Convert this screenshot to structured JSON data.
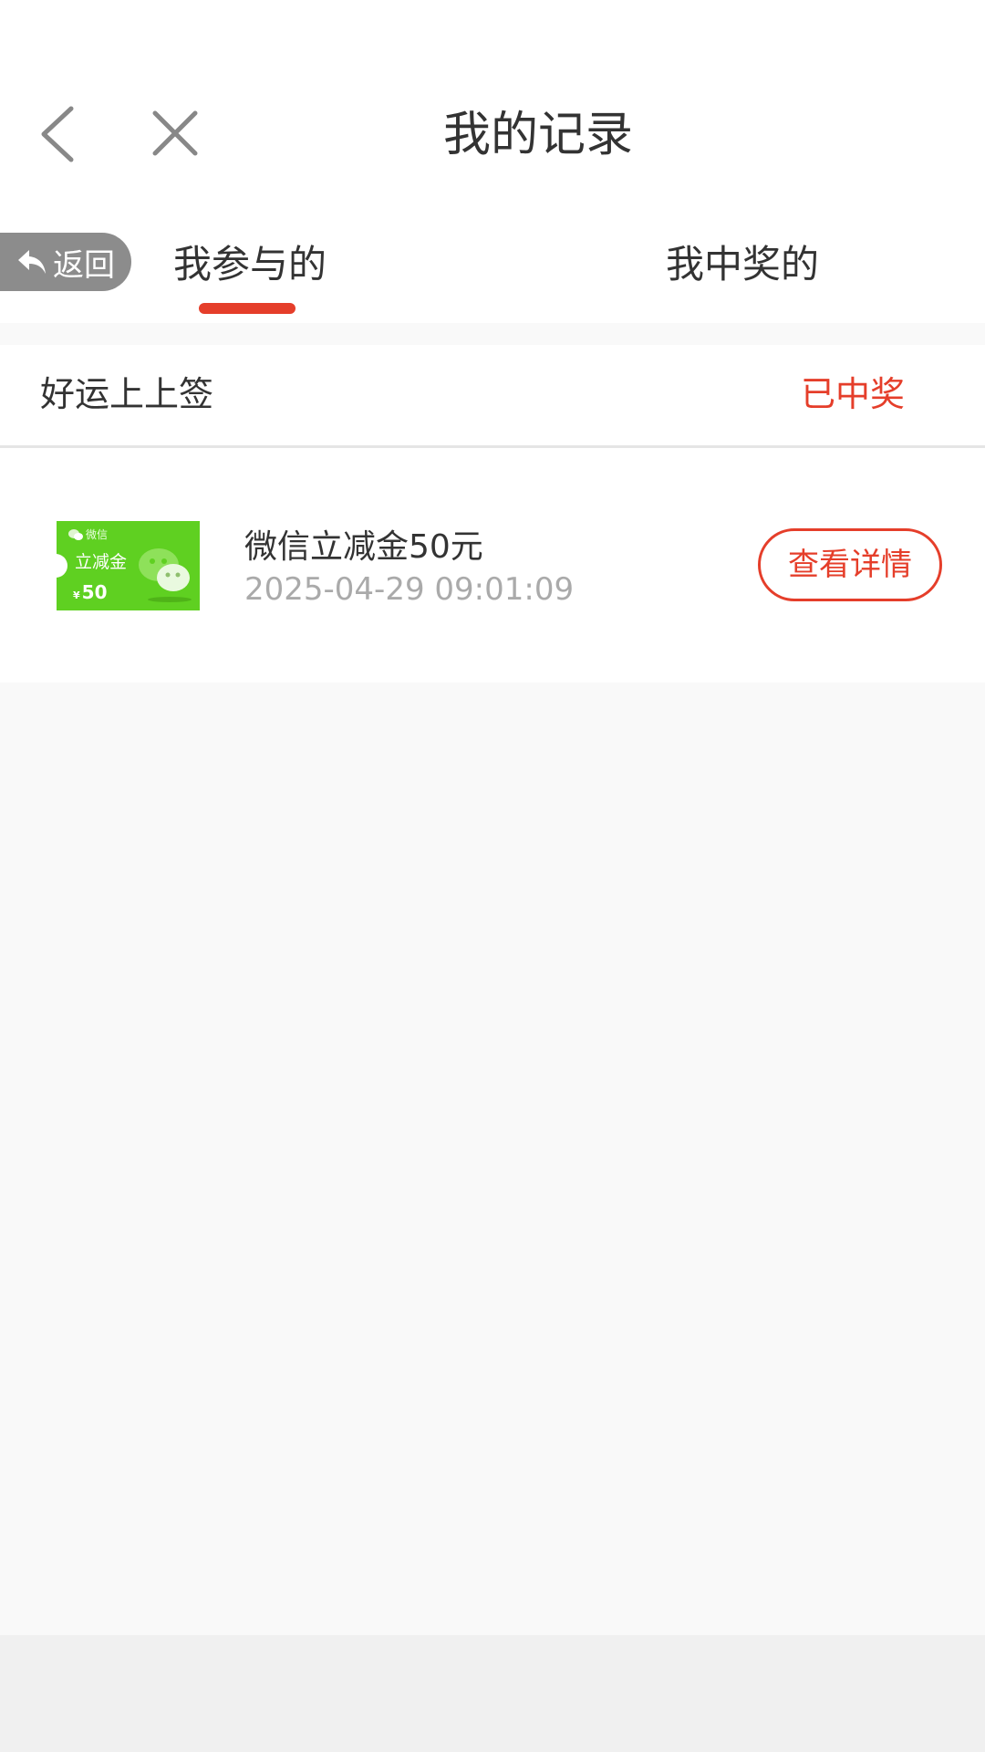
{
  "header": {
    "title": "我的记录"
  },
  "tabs": {
    "back_label": "返回",
    "items": [
      {
        "label": "我参与的",
        "active": true
      },
      {
        "label": "我中奖的",
        "active": false
      }
    ]
  },
  "record": {
    "activity_name": "好运上上签",
    "status": "已中奖",
    "prize": {
      "thumbnail": {
        "brand": "微信",
        "title": "立减金",
        "currency": "¥",
        "amount": "50"
      },
      "name": "微信立减金50元",
      "time": "2025-04-29 09:01:09",
      "detail_button": "查看详情"
    }
  },
  "colors": {
    "accent": "#e53e2a",
    "thumbnail_green": "#5fd021",
    "muted_text": "#aaaaaa",
    "back_pill": "#8c8c8c"
  },
  "icons": {
    "nav_back": "chevron-left-icon",
    "nav_close": "close-icon",
    "back_pill": "reply-arrow-icon"
  }
}
